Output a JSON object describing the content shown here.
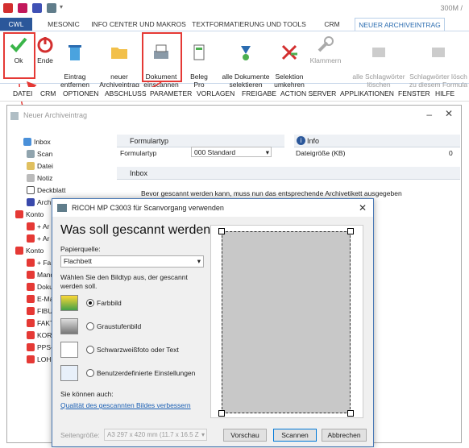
{
  "app": {
    "title": "300M /"
  },
  "ribbon_tabs": [
    {
      "label": "CWL"
    },
    {
      "label": "MESONIC"
    },
    {
      "label": "INFO CENTER UND MAKROS"
    },
    {
      "label": "TEXTFORMATIERUNG UND TOOLS"
    },
    {
      "label": "CRM"
    },
    {
      "label": "NEUER ARCHIVEINTRAG"
    }
  ],
  "ribbon": {
    "ok": "Ok",
    "ende": "Ende",
    "eintrag": "Eintrag\nentfernen",
    "neuer": "neuer\nArchiveintrag",
    "dokument": "Dokument\neinscannen",
    "beleg": "Beleg\nPro",
    "alle": "alle Dokumente\nselektieren",
    "selektion": "Selektion\numkehren",
    "klammern": "Klammern",
    "alle_sw": "alle Schlagwörter\nlöschen",
    "sw_loeschen": "Schlagwörter lösch\nzu diesem Formula"
  },
  "menu": [
    "DATEI",
    "CRM",
    "OPTIONEN",
    "ABSCHLUSS",
    "PARAMETER",
    "VORLAGEN",
    "FREIGABE",
    "ACTION SERVER",
    "APPLIKATIONEN",
    "FENSTER",
    "HILFE"
  ],
  "bgwindow": {
    "title": "Neuer Archiveintrag",
    "tree": [
      "Inbox",
      "Scan",
      "Datei",
      "Notiz",
      "Deckblatt",
      "Archiv",
      "Konto",
      "+ Ar",
      "+ Ar",
      "Konto",
      "+ Fa",
      "Mand",
      "Doku",
      "E-Mai",
      "FIBU-",
      "FAKT",
      "KORE",
      "PPS-E",
      "LOHN"
    ],
    "formulartyp": {
      "header": "Formulartyp",
      "label": "Formulartyp",
      "value": "000 Standard"
    },
    "info": {
      "header": "Info",
      "label": "Dateigröße (KB)",
      "value": "0"
    },
    "inbox": {
      "header": "Inbox",
      "text": "Bevor gescannt werden kann, muss nun das entsprechende Archivetikett ausgegeben"
    }
  },
  "dialog": {
    "title": "RICOH MP C3003 für Scanvorgang verwenden",
    "heading": "Was soll gescannt werden?",
    "papierquelle_label": "Papierquelle:",
    "papierquelle_value": "Flachbett",
    "bildtyp_label": "Wählen Sie den Bildtyp aus, der gescannt werden soll.",
    "options": [
      {
        "label": "Farbbild",
        "selected": true
      },
      {
        "label": "Graustufenbild",
        "selected": false
      },
      {
        "label": "Schwarzweißfoto oder Text",
        "selected": false
      },
      {
        "label": "Benutzerdefinierte Einstellungen",
        "selected": false
      }
    ],
    "sie_koennen": "Sie können auch:",
    "link": "Qualität des gescannten Bildes verbessern",
    "seitengroesse_label": "Seitengröße:",
    "seitengroesse_value": "A3 297 x 420 mm (11.7 x 16.5 Z",
    "buttons": {
      "vorschau": "Vorschau",
      "scannen": "Scannen",
      "abbrechen": "Abbrechen"
    }
  },
  "colors": {
    "accent": "#2b579a",
    "highlight": "#e53935",
    "link": "#1a5fb4"
  }
}
